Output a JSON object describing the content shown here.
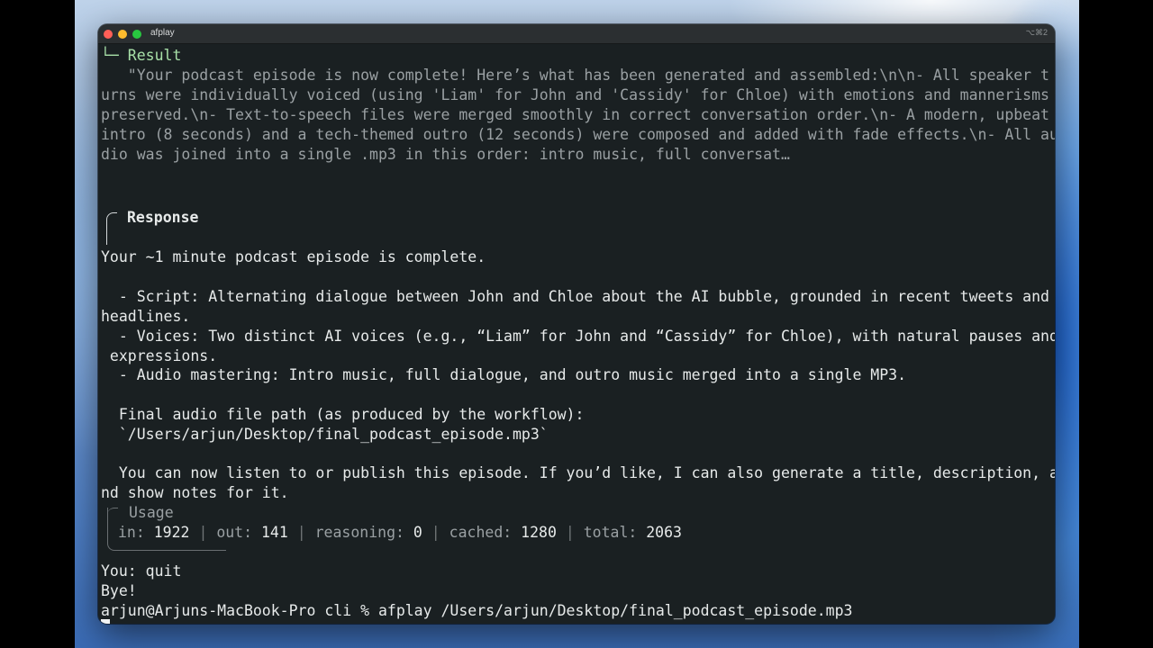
{
  "window": {
    "title": "afplay",
    "shortcut": "⌥⌘2"
  },
  "result": {
    "header": "└─ Result",
    "lines": [
      "   \"Your podcast episode is now complete! Here’s what has been generated and assembled:\\n\\n- All speaker t",
      "urns were individually voiced (using 'Liam' for John and 'Cassidy' for Chloe) with emotions and mannerisms",
      "preserved.\\n- Text-to-speech files were merged smoothly in correct conversation order.\\n- A modern, upbeat",
      "intro (8 seconds) and a tech-themed outro (12 seconds) were composed and added with fade effects.\\n- All au",
      "dio was joined into a single .mp3 in this order: intro music, full conversat…"
    ]
  },
  "response": {
    "header": "Response",
    "lines": [
      "Your ~1 minute podcast episode is complete.",
      "",
      "  - Script: Alternating dialogue between John and Chloe about the AI bubble, grounded in recent tweets and",
      "headlines.",
      "  - Voices: Two distinct AI voices (e.g., “Liam” for John and “Cassidy” for Chloe), with natural pauses and",
      " expressions.",
      "  - Audio mastering: Intro music, full dialogue, and outro music merged into a single MP3.",
      "",
      "  Final audio file path (as produced by the workflow):",
      "  `/Users/arjun/Desktop/final_podcast_episode.mp3`",
      "",
      "  You can now listen to or publish this episode. If you’d like, I can also generate a title, description, a",
      "nd show notes for it."
    ]
  },
  "usage": {
    "header": "Usage",
    "in_label": "in:",
    "in_value": "1922",
    "out_label": "out:",
    "out_value": "141",
    "reasoning_label": "reasoning:",
    "reasoning_value": "0",
    "cached_label": "cached:",
    "cached_value": "1280",
    "total_label": "total:",
    "total_value": "2063",
    "separator": "|"
  },
  "footer": {
    "you_line": "You: quit",
    "bye_line": "Bye!",
    "prompt_line": "arjun@Arjuns-MacBook-Pro cli % afplay /Users/arjun/Desktop/final_podcast_episode.mp3"
  }
}
